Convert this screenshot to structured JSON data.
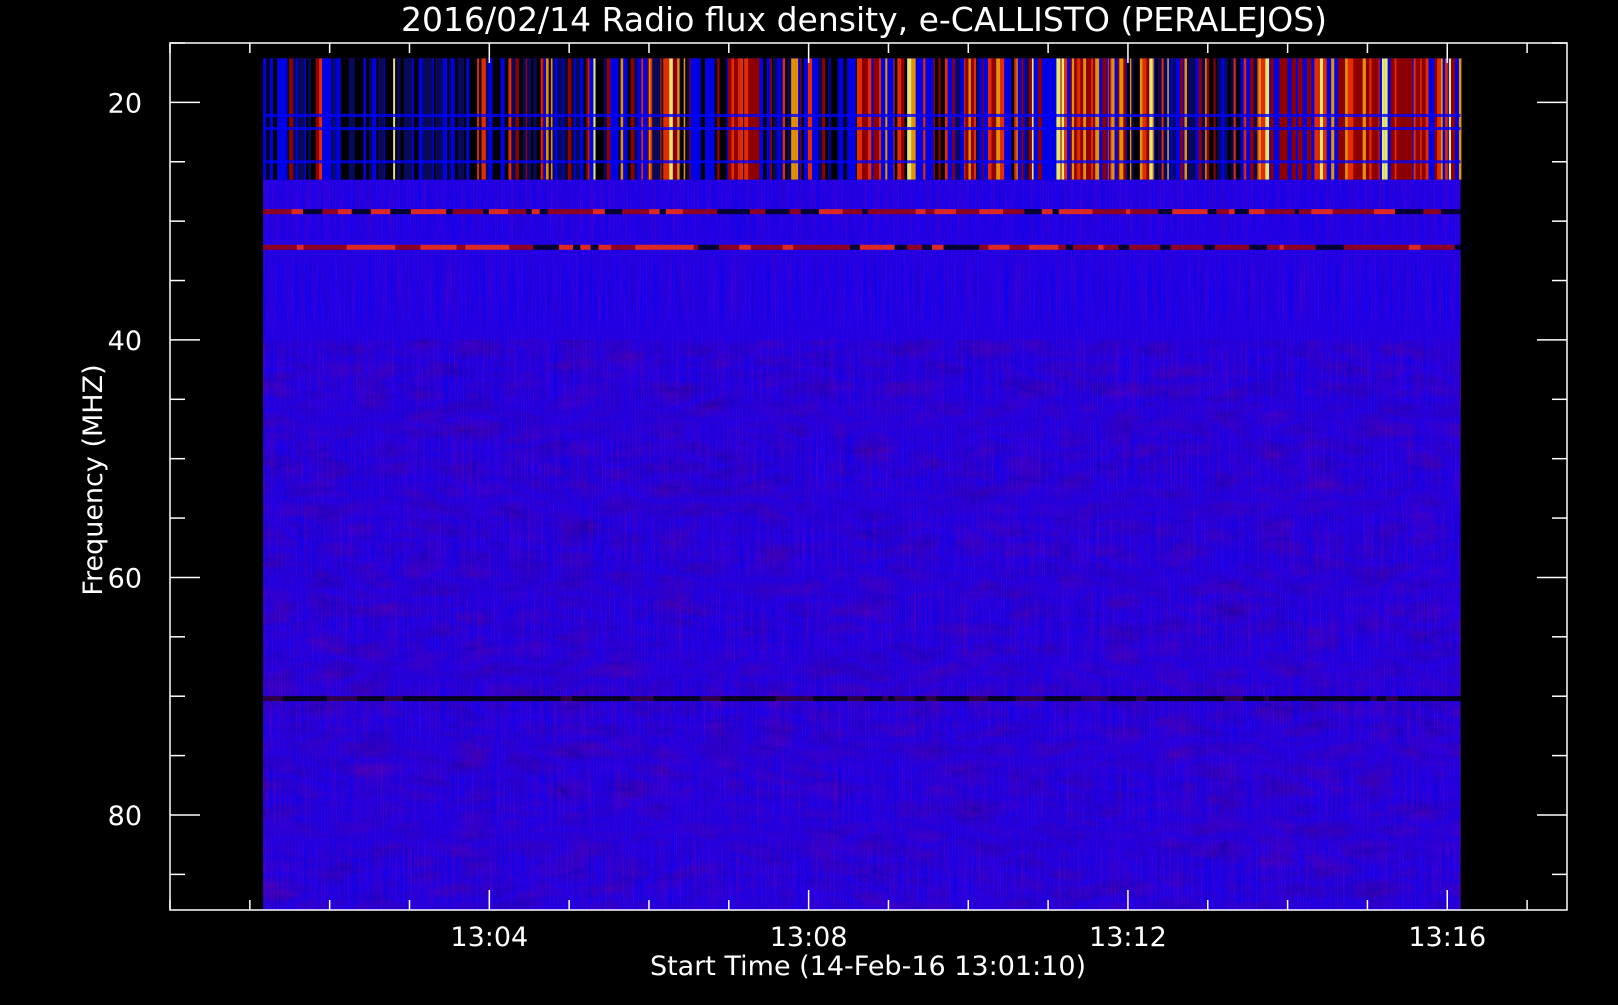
{
  "chart_data": {
    "type": "heatmap",
    "title": "2016/02/14  Radio flux density, e-CALLISTO (PERALEJOS)",
    "xlabel": "Start Time (14-Feb-16 13:01:10)",
    "ylabel": "Frequency (MHZ)",
    "x_major_ticks": [
      "13:04",
      "13:08",
      "13:12",
      "13:16"
    ],
    "y_major_ticks": [
      20,
      40,
      60,
      80
    ],
    "y_minor_step": 5,
    "x_minor_step_minutes": 1,
    "x_range": [
      "13:00:00",
      "13:17:30"
    ],
    "ylim": [
      88,
      15
    ],
    "data_time_range": [
      "13:01:10",
      "13:16:10"
    ],
    "data_freq_range": [
      16.3,
      89.6
    ],
    "colormap": [
      "#000000",
      "#0000ff",
      "#a00000",
      "#ff3000",
      "#ffa000",
      "#ffff80"
    ],
    "background_level_color": "#0000ff",
    "features": [
      {
        "label": "strong bursts band",
        "freq": [
          16.3,
          26.5
        ],
        "intensity": "high"
      },
      {
        "label": "emission line",
        "freq": 29.2,
        "intensity": "medium"
      },
      {
        "label": "emission line",
        "freq": 32.2,
        "intensity": "medium"
      },
      {
        "label": "dark line",
        "freq": 70.2,
        "intensity": "low"
      }
    ]
  }
}
